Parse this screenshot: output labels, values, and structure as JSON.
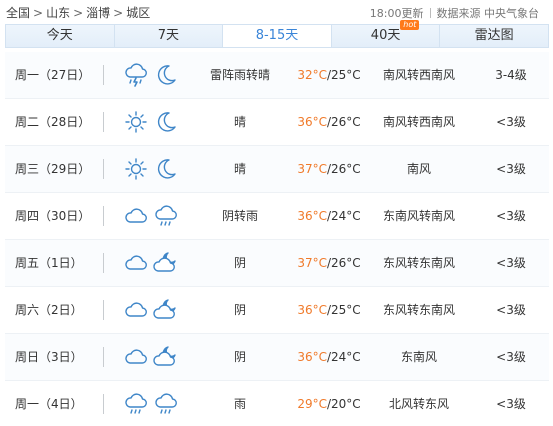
{
  "breadcrumb": [
    "全国",
    "山东",
    "淄博",
    "城区"
  ],
  "meta": {
    "update_time": "18:00更新",
    "source": "数据来源 中央气象台"
  },
  "tabs": [
    {
      "label": "今天",
      "active": false
    },
    {
      "label": "7天",
      "active": false
    },
    {
      "label": "8-15天",
      "active": true
    },
    {
      "label": "40天",
      "active": false,
      "badge": "hot"
    },
    {
      "label": "雷达图",
      "active": false
    }
  ],
  "forecast": [
    {
      "day": "周一（27日）",
      "icons": [
        "cloud-thunder-rain-icon",
        "moon-icon"
      ],
      "desc": "雷阵雨转晴",
      "high": "32°C",
      "low": "/25°C",
      "wind": "南风转西南风",
      "level": "3-4级"
    },
    {
      "day": "周二（28日）",
      "icons": [
        "sun-icon",
        "moon-icon"
      ],
      "desc": "晴",
      "high": "36°C",
      "low": "/26°C",
      "wind": "南风转西南风",
      "level": "<3级"
    },
    {
      "day": "周三（29日）",
      "icons": [
        "sun-icon",
        "moon-icon"
      ],
      "desc": "晴",
      "high": "37°C",
      "low": "/26°C",
      "wind": "南风",
      "level": "<3级"
    },
    {
      "day": "周四（30日）",
      "icons": [
        "cloudy-icon",
        "cloud-rain-icon"
      ],
      "desc": "阴转雨",
      "high": "36°C",
      "low": "/24°C",
      "wind": "东南风转南风",
      "level": "<3级"
    },
    {
      "day": "周五（1日）",
      "icons": [
        "cloudy-icon",
        "cloud-moon-icon"
      ],
      "desc": "阴",
      "high": "37°C",
      "low": "/26°C",
      "wind": "东风转东南风",
      "level": "<3级"
    },
    {
      "day": "周六（2日）",
      "icons": [
        "cloudy-icon",
        "cloud-moon-icon"
      ],
      "desc": "阴",
      "high": "36°C",
      "low": "/25°C",
      "wind": "东风转东南风",
      "level": "<3级"
    },
    {
      "day": "周日（3日）",
      "icons": [
        "cloudy-icon",
        "cloud-moon-icon"
      ],
      "desc": "阴",
      "high": "36°C",
      "low": "/24°C",
      "wind": "东南风",
      "level": "<3级"
    },
    {
      "day": "周一（4日）",
      "icons": [
        "cloud-rain-icon",
        "cloud-rain-icon"
      ],
      "desc": "雨",
      "high": "29°C",
      "low": "/20°C",
      "wind": "北风转东风",
      "level": "<3级"
    }
  ],
  "colors": {
    "accent": "#3a85d8",
    "high_temp": "#f07a2a",
    "icon_stroke": "#3f86c8",
    "tab_bg": "#e3eef9",
    "hot_badge": "#ff7a1a"
  }
}
